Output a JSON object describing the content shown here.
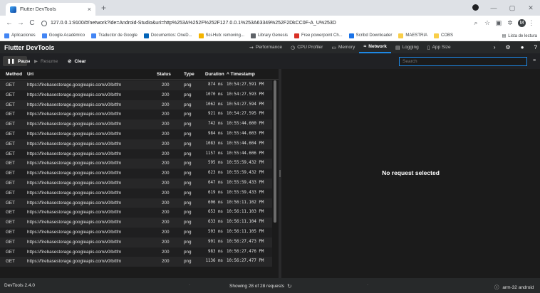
{
  "browser": {
    "tab_title": "Flutter DevTools",
    "tab_close": "×",
    "new_tab": "+",
    "url_host": "127.0.0.1:9100",
    "url_rest": "/#/network?ide=Android-Studio&uri=http%253A%252F%252F127.0.0.1%253A63349%252F2DkCC0F-A_U%253D",
    "nav": {
      "back": "←",
      "forward": "→",
      "reload": "C"
    },
    "profile_initial": "M",
    "bookmarks": [
      {
        "label": "Aplicaciones",
        "icon": "apps-icon",
        "color": "#4285f4"
      },
      {
        "label": "Google Académico",
        "icon": "scholar-icon",
        "color": "#4285f4"
      },
      {
        "label": "Traductor de Google",
        "icon": "translate-icon",
        "color": "#4285f4"
      },
      {
        "label": "Documentos: OneD...",
        "icon": "onedrive-icon",
        "color": "#0364b8"
      },
      {
        "label": "Sci-Hub: removing...",
        "icon": "scihub-icon",
        "color": "#f4b400"
      },
      {
        "label": "Library Genesis",
        "icon": "libgen-icon",
        "color": "#5f6368"
      },
      {
        "label": "Free powerpoint Ch...",
        "icon": "ppt-icon",
        "color": "#d93025"
      },
      {
        "label": "Scribd Downloader",
        "icon": "scribd-icon",
        "color": "#1a73e8"
      },
      {
        "label": "MAESTRIA",
        "icon": "folder-icon",
        "color": "#f9ce48"
      },
      {
        "label": "COBS",
        "icon": "folder-icon",
        "color": "#f9ce48"
      }
    ],
    "reading_list": "Lista de lectura"
  },
  "app": {
    "title": "Flutter DevTools",
    "tabs": [
      {
        "label": "Performance",
        "icon": "performance-icon",
        "glyph": "⇝",
        "active": false
      },
      {
        "label": "CPU Profiler",
        "icon": "cpu-profiler-icon",
        "glyph": "◷",
        "active": false
      },
      {
        "label": "Memory",
        "icon": "memory-icon",
        "glyph": "▭",
        "active": false
      },
      {
        "label": "Network",
        "icon": "network-icon",
        "glyph": "≈",
        "active": true
      },
      {
        "label": "Logging",
        "icon": "logging-icon",
        "glyph": "▤",
        "active": false
      },
      {
        "label": "App Size",
        "icon": "app-size-icon",
        "glyph": "▯",
        "active": false
      }
    ]
  },
  "controls": {
    "pause_label": "Pause",
    "resume_label": "Resume",
    "clear_label": "Clear",
    "search_placeholder": "Search"
  },
  "table": {
    "columns": {
      "method": "Method",
      "uri": "Uri",
      "status": "Status",
      "type": "Type",
      "duration": "Duration",
      "timestamp": "^ Timestamp"
    },
    "rows": [
      {
        "method": "GET",
        "uri": "https://firebasestorage.googleapis.com/v0/b/tfm",
        "status": "200",
        "type": "png",
        "duration": "874 ms",
        "timestamp": "10:54:27.591 PM"
      },
      {
        "method": "GET",
        "uri": "https://firebasestorage.googleapis.com/v0/b/tfm",
        "status": "200",
        "type": "png",
        "duration": "1070 ms",
        "timestamp": "10:54:27.593 PM"
      },
      {
        "method": "GET",
        "uri": "https://firebasestorage.googleapis.com/v0/b/tfm",
        "status": "200",
        "type": "png",
        "duration": "1062 ms",
        "timestamp": "10:54:27.594 PM"
      },
      {
        "method": "GET",
        "uri": "https://firebasestorage.googleapis.com/v0/b/tfm",
        "status": "200",
        "type": "png",
        "duration": "921 ms",
        "timestamp": "10:54:27.595 PM"
      },
      {
        "method": "GET",
        "uri": "https://firebasestorage.googleapis.com/v0/b/tfm",
        "status": "200",
        "type": "png",
        "duration": "742 ms",
        "timestamp": "10:55:44.600 PM"
      },
      {
        "method": "GET",
        "uri": "https://firebasestorage.googleapis.com/v0/b/tfm",
        "status": "200",
        "type": "png",
        "duration": "984 ms",
        "timestamp": "10:55:44.603 PM"
      },
      {
        "method": "GET",
        "uri": "https://firebasestorage.googleapis.com/v0/b/tfm",
        "status": "200",
        "type": "png",
        "duration": "1083 ms",
        "timestamp": "10:55:44.604 PM"
      },
      {
        "method": "GET",
        "uri": "https://firebasestorage.googleapis.com/v0/b/tfm",
        "status": "200",
        "type": "png",
        "duration": "1157 ms",
        "timestamp": "10:55:44.606 PM"
      },
      {
        "method": "GET",
        "uri": "https://firebasestorage.googleapis.com/v0/b/tfm",
        "status": "200",
        "type": "png",
        "duration": "595 ms",
        "timestamp": "10:55:59.432 PM"
      },
      {
        "method": "GET",
        "uri": "https://firebasestorage.googleapis.com/v0/b/tfm",
        "status": "200",
        "type": "png",
        "duration": "623 ms",
        "timestamp": "10:55:59.432 PM"
      },
      {
        "method": "GET",
        "uri": "https://firebasestorage.googleapis.com/v0/b/tfm",
        "status": "200",
        "type": "png",
        "duration": "647 ms",
        "timestamp": "10:55:59.433 PM"
      },
      {
        "method": "GET",
        "uri": "https://firebasestorage.googleapis.com/v0/b/tfm",
        "status": "200",
        "type": "png",
        "duration": "619 ms",
        "timestamp": "10:55:59.433 PM"
      },
      {
        "method": "GET",
        "uri": "https://firebasestorage.googleapis.com/v0/b/tfm",
        "status": "200",
        "type": "png",
        "duration": "606 ms",
        "timestamp": "10:56:11.102 PM"
      },
      {
        "method": "GET",
        "uri": "https://firebasestorage.googleapis.com/v0/b/tfm",
        "status": "200",
        "type": "png",
        "duration": "653 ms",
        "timestamp": "10:56:11.103 PM"
      },
      {
        "method": "GET",
        "uri": "https://firebasestorage.googleapis.com/v0/b/tfm",
        "status": "200",
        "type": "png",
        "duration": "633 ms",
        "timestamp": "10:56:11.104 PM"
      },
      {
        "method": "GET",
        "uri": "https://firebasestorage.googleapis.com/v0/b/tfm",
        "status": "200",
        "type": "png",
        "duration": "503 ms",
        "timestamp": "10:56:11.105 PM"
      },
      {
        "method": "GET",
        "uri": "https://firebasestorage.googleapis.com/v0/b/tfm",
        "status": "200",
        "type": "png",
        "duration": "901 ms",
        "timestamp": "10:56:27.473 PM"
      },
      {
        "method": "GET",
        "uri": "https://firebasestorage.googleapis.com/v0/b/tfm",
        "status": "200",
        "type": "png",
        "duration": "983 ms",
        "timestamp": "10:56:27.476 PM"
      },
      {
        "method": "GET",
        "uri": "https://firebasestorage.googleapis.com/v0/b/tfm",
        "status": "200",
        "type": "png",
        "duration": "1136 ms",
        "timestamp": "10:56:27.477 PM"
      }
    ]
  },
  "detail": {
    "empty_message": "No request selected"
  },
  "status_bar": {
    "version": "DevTools 2.4.0",
    "separator": "·",
    "showing": "Showing 28 of 28 requests",
    "platform": "arm-32 android"
  },
  "colors": {
    "app_bg": "#1b1b1b",
    "header_bg": "#27292a",
    "accent": "#1e88e5",
    "row_odd": "#272728",
    "row_even": "#1f1f20"
  }
}
